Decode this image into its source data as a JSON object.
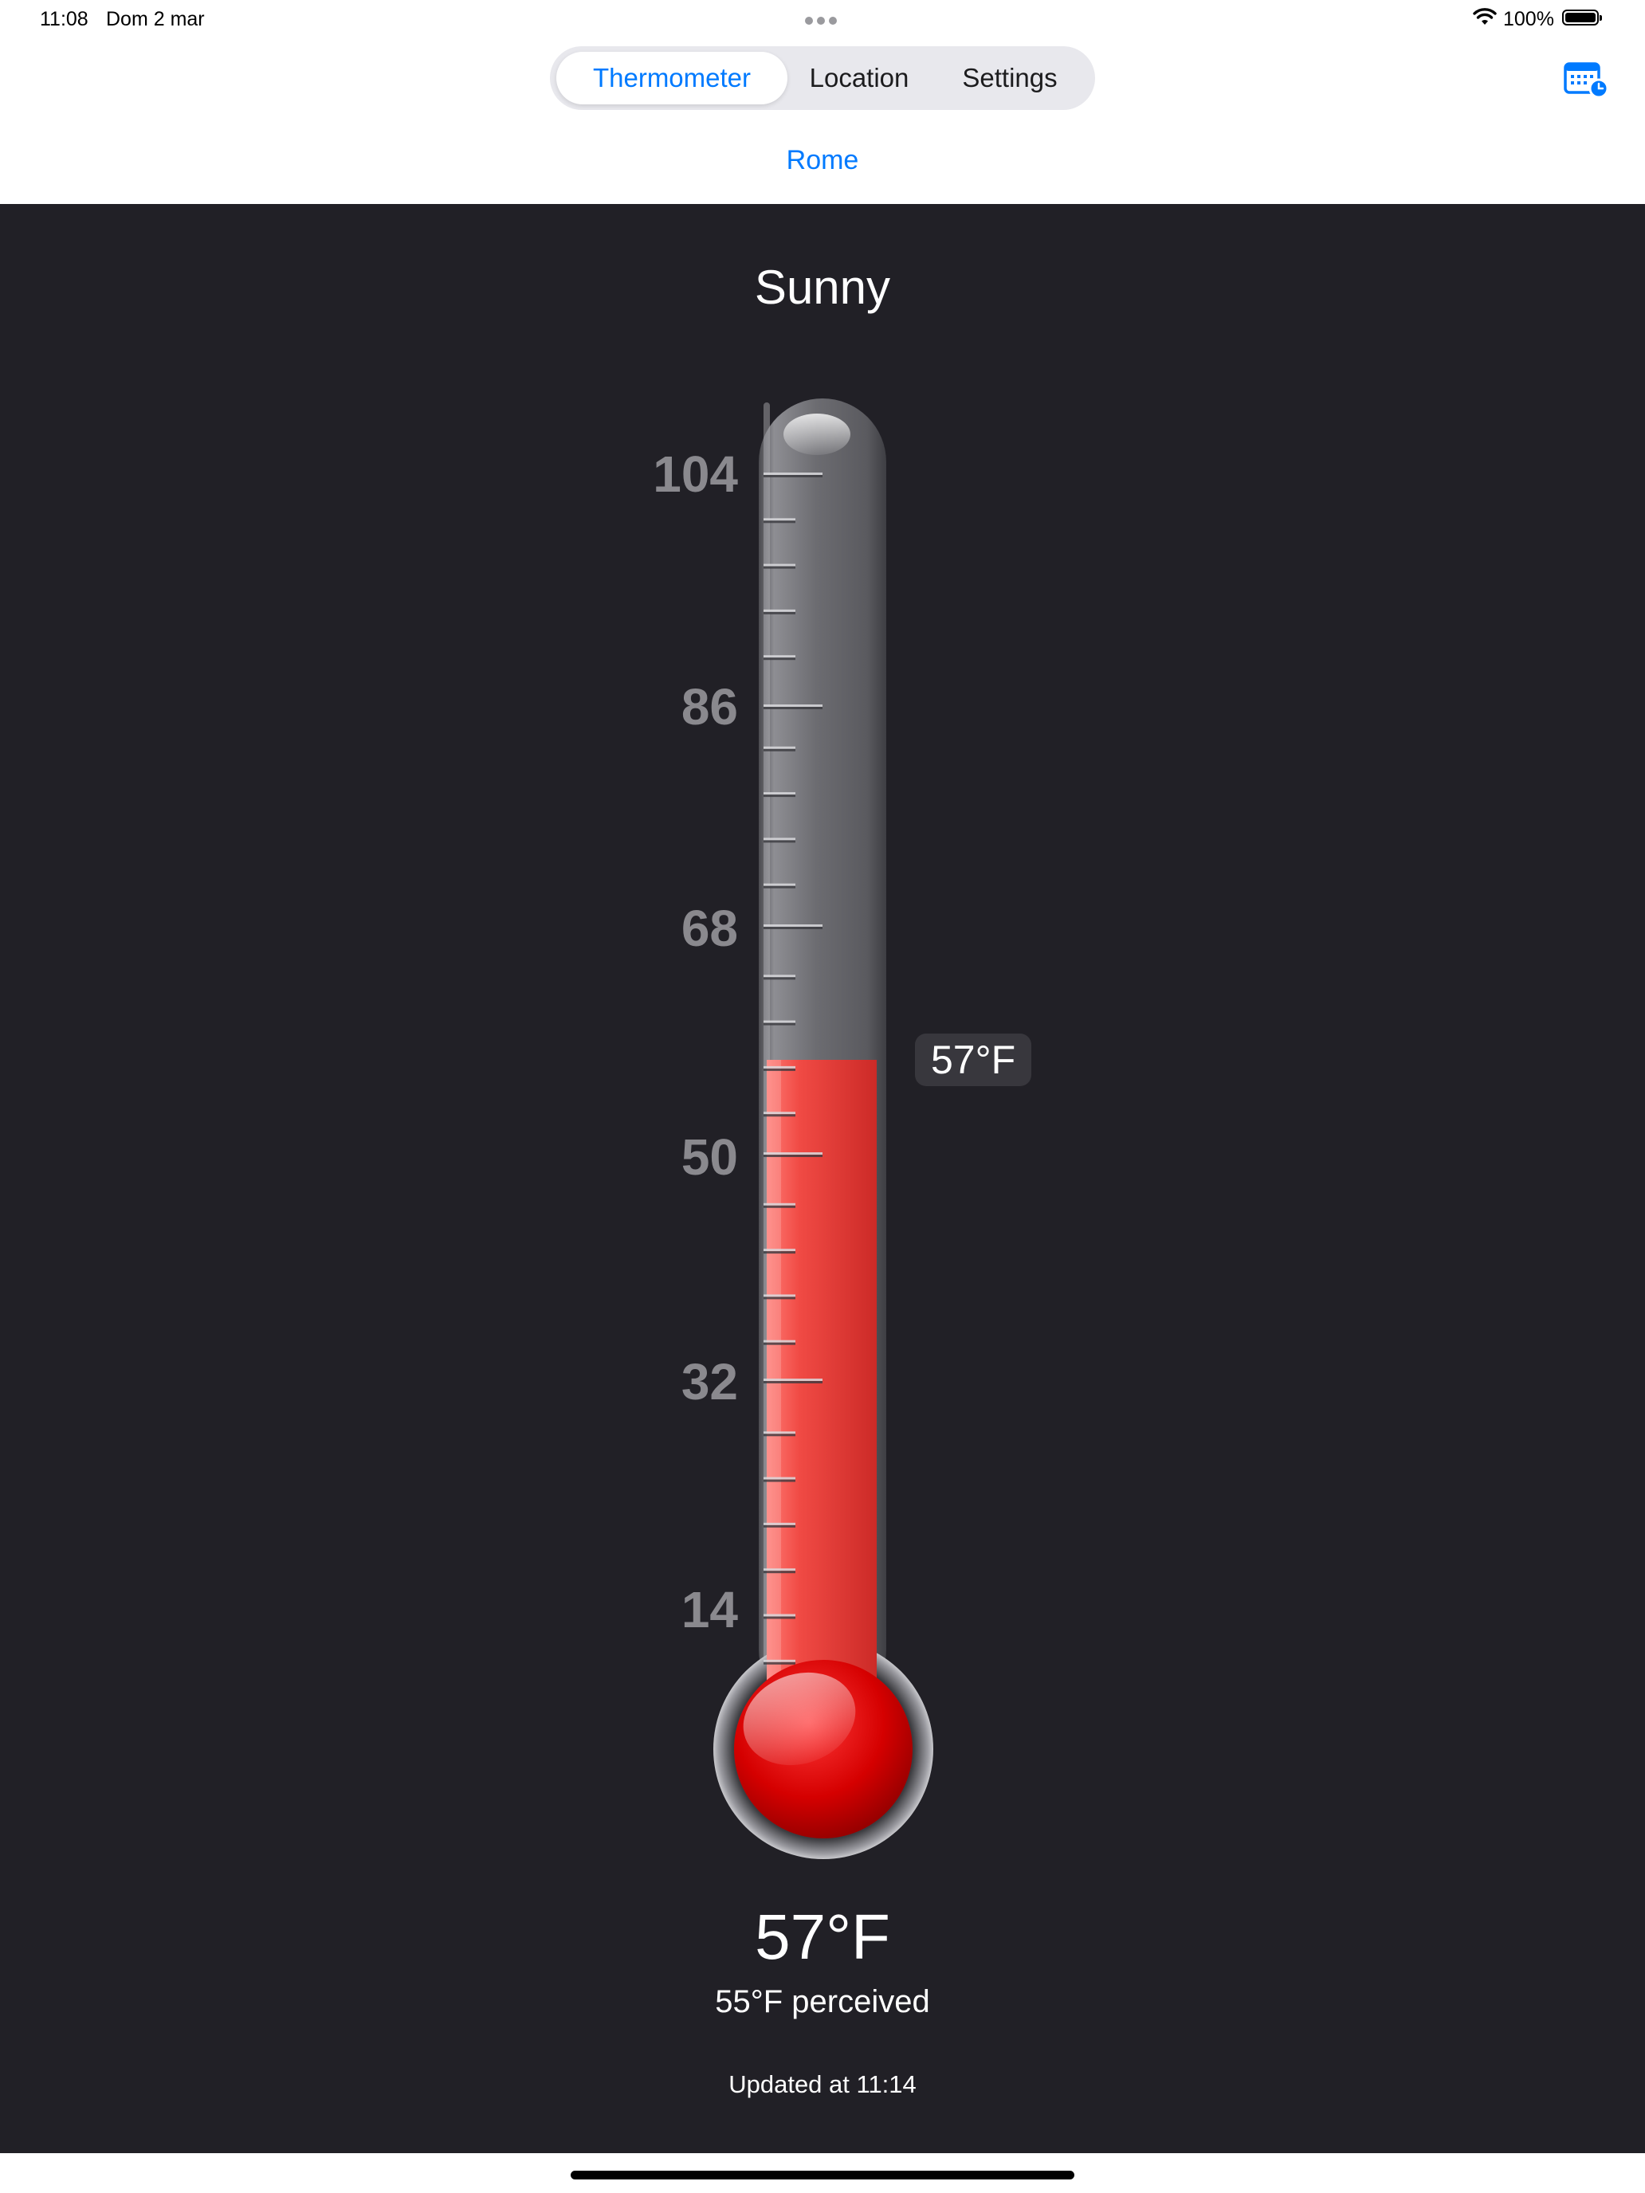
{
  "status_bar": {
    "time": "11:08",
    "date": "Dom 2 mar",
    "battery": "100%"
  },
  "tabs": [
    {
      "label": "Thermometer",
      "selected": true
    },
    {
      "label": "Location",
      "selected": false
    },
    {
      "label": "Settings",
      "selected": false
    }
  ],
  "location": "Rome",
  "weather": {
    "condition": "Sunny",
    "temperature": "57°F",
    "temperature_value": 57,
    "perceived": "55°F perceived",
    "updated": "Updated at 11:14"
  },
  "thermometer": {
    "unit": "°F",
    "scale_labels": [
      "104",
      "86",
      "68",
      "50",
      "32",
      "14"
    ],
    "fill_color": "#e0322e",
    "bulb_color": "#d20000"
  },
  "colors": {
    "accent": "#007aff",
    "background": "#212026",
    "scale_label": "#8a898e"
  },
  "icons": {
    "calendar": "calendar-clock-icon",
    "wifi": "wifi-icon",
    "battery": "battery-icon",
    "more": "ellipsis-icon"
  }
}
